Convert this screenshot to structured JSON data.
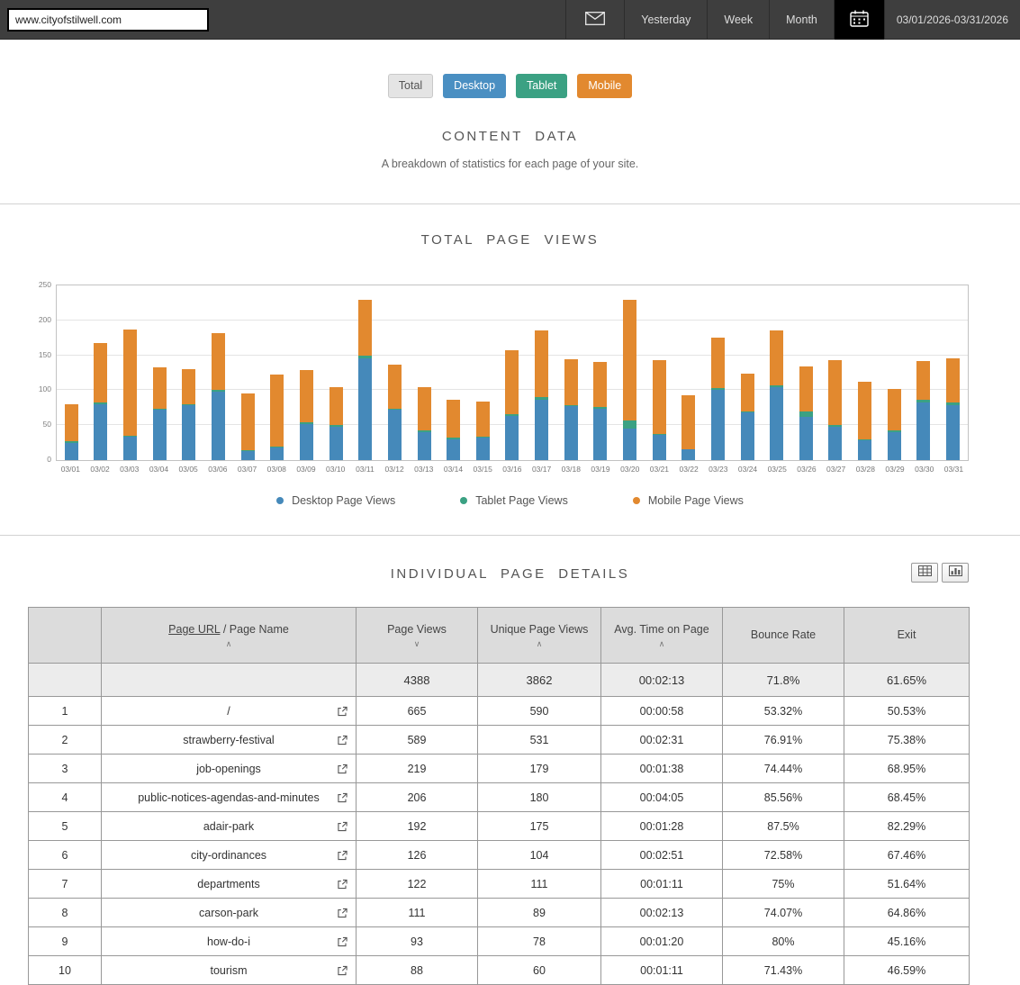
{
  "topbar": {
    "url_value": "www.cityofstilwell.com",
    "tabs": [
      {
        "label": "Yesterday"
      },
      {
        "label": "Week"
      },
      {
        "label": "Month"
      }
    ],
    "date_range": "03/01/2026-03/31/2026"
  },
  "filters": {
    "buttons": [
      {
        "label": "Total",
        "bg": "#e4e4e4",
        "color": "#555555",
        "border": "#c9c9c9"
      },
      {
        "label": "Desktop",
        "bg": "#4a8fc2",
        "color": "#ffffff",
        "border": "#4a8fc2"
      },
      {
        "label": "Tablet",
        "bg": "#3ba183",
        "color": "#ffffff",
        "border": "#3ba183"
      },
      {
        "label": "Mobile",
        "bg": "#e2892f",
        "color": "#ffffff",
        "border": "#e2892f"
      }
    ]
  },
  "content": {
    "title": "CONTENT DATA",
    "subtitle": "A breakdown of statistics for each page of your site."
  },
  "chart_section": {
    "title": "TOTAL PAGE VIEWS"
  },
  "chart_data": {
    "type": "bar",
    "stacked": true,
    "title": "TOTAL PAGE VIEWS",
    "xlabel": "",
    "ylabel": "",
    "ylim": [
      0,
      250
    ],
    "yticks": [
      0,
      50,
      100,
      150,
      200,
      250
    ],
    "grid": true,
    "legend_position": "bottom",
    "categories": [
      "03/01",
      "03/02",
      "03/03",
      "03/04",
      "03/05",
      "03/06",
      "03/07",
      "03/08",
      "03/09",
      "03/10",
      "03/11",
      "03/12",
      "03/13",
      "03/14",
      "03/15",
      "03/16",
      "03/17",
      "03/18",
      "03/19",
      "03/20",
      "03/21",
      "03/22",
      "03/23",
      "03/24",
      "03/25",
      "03/26",
      "03/27",
      "03/28",
      "03/29",
      "03/30",
      "03/31"
    ],
    "series": [
      {
        "name": "Desktop Page Views",
        "color": "#4589ba",
        "values": [
          25,
          80,
          33,
          72,
          78,
          98,
          13,
          18,
          52,
          48,
          146,
          72,
          40,
          30,
          32,
          63,
          87,
          77,
          74,
          45,
          36,
          15,
          100,
          68,
          104,
          62,
          48,
          28,
          40,
          82,
          79
        ]
      },
      {
        "name": "Tablet Page Views",
        "color": "#3ba183",
        "values": [
          2,
          2,
          2,
          2,
          2,
          2,
          1,
          2,
          2,
          2,
          3,
          2,
          2,
          2,
          2,
          3,
          3,
          2,
          2,
          12,
          2,
          1,
          3,
          2,
          3,
          7,
          2,
          2,
          2,
          4,
          3
        ]
      },
      {
        "name": "Mobile Page Views",
        "color": "#e2892f",
        "values": [
          53,
          85,
          152,
          59,
          50,
          82,
          82,
          102,
          75,
          55,
          80,
          63,
          63,
          55,
          50,
          91,
          96,
          66,
          64,
          173,
          105,
          77,
          72,
          54,
          78,
          65,
          93,
          82,
          60,
          56,
          64
        ]
      }
    ]
  },
  "details": {
    "title": "INDIVIDUAL PAGE DETAILS",
    "header": {
      "rank": "",
      "page_url_link": "Page URL",
      "page_url_rest": " / Page Name",
      "views": "Page Views",
      "unique": "Unique Page Views",
      "avg_time": "Avg. Time on Page",
      "bounce": "Bounce Rate",
      "exit": "Exit"
    },
    "summary": {
      "views": "4388",
      "unique": "3862",
      "avg_time": "00:02:13",
      "bounce": "71.8%",
      "exit": "61.65%"
    },
    "rows": [
      {
        "rank": "1",
        "page": "/",
        "views": "665",
        "unique": "590",
        "avg_time": "00:00:58",
        "bounce": "53.32%",
        "exit": "50.53%"
      },
      {
        "rank": "2",
        "page": "strawberry-festival",
        "views": "589",
        "unique": "531",
        "avg_time": "00:02:31",
        "bounce": "76.91%",
        "exit": "75.38%"
      },
      {
        "rank": "3",
        "page": "job-openings",
        "views": "219",
        "unique": "179",
        "avg_time": "00:01:38",
        "bounce": "74.44%",
        "exit": "68.95%"
      },
      {
        "rank": "4",
        "page": "public-notices-agendas-and-minutes",
        "views": "206",
        "unique": "180",
        "avg_time": "00:04:05",
        "bounce": "85.56%",
        "exit": "68.45%"
      },
      {
        "rank": "5",
        "page": "adair-park",
        "views": "192",
        "unique": "175",
        "avg_time": "00:01:28",
        "bounce": "87.5%",
        "exit": "82.29%"
      },
      {
        "rank": "6",
        "page": "city-ordinances",
        "views": "126",
        "unique": "104",
        "avg_time": "00:02:51",
        "bounce": "72.58%",
        "exit": "67.46%"
      },
      {
        "rank": "7",
        "page": "departments",
        "views": "122",
        "unique": "111",
        "avg_time": "00:01:11",
        "bounce": "75%",
        "exit": "51.64%"
      },
      {
        "rank": "8",
        "page": "carson-park",
        "views": "111",
        "unique": "89",
        "avg_time": "00:02:13",
        "bounce": "74.07%",
        "exit": "64.86%"
      },
      {
        "rank": "9",
        "page": "how-do-i",
        "views": "93",
        "unique": "78",
        "avg_time": "00:01:20",
        "bounce": "80%",
        "exit": "45.16%"
      },
      {
        "rank": "10",
        "page": "tourism",
        "views": "88",
        "unique": "60",
        "avg_time": "00:01:11",
        "bounce": "71.43%",
        "exit": "46.59%"
      }
    ]
  },
  "icons": {
    "mail": "envelope",
    "calendar": "calendar",
    "sort_asc": "∧",
    "sort_desc": "∨",
    "external_link": "box-arrow",
    "table_view": "grid",
    "chart_view": "bars"
  }
}
